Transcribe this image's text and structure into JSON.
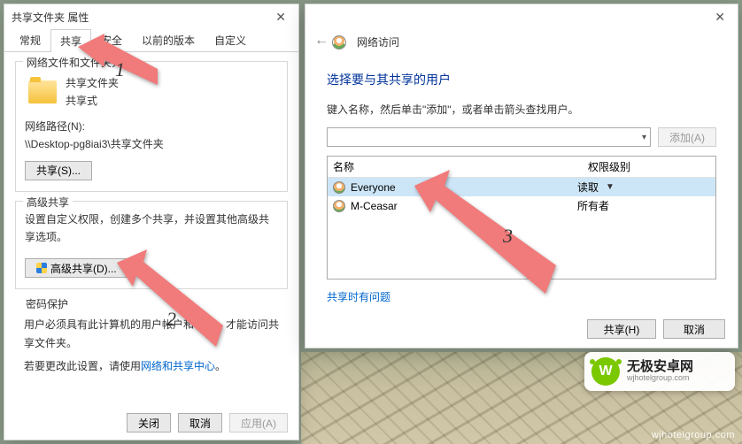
{
  "win1": {
    "title": "共享文件夹 属性",
    "tabs": [
      "常规",
      "共享",
      "安全",
      "以前的版本",
      "自定义"
    ],
    "active_tab": 1,
    "group1": {
      "title": "网络文件和文件夹共享",
      "folder_name": "共享文件夹",
      "status": "共享式",
      "path_label": "网络路径(N):",
      "path_value": "\\\\Desktop-pg8iai3\\共享文件夹",
      "share_btn": "共享(S)..."
    },
    "group2": {
      "title": "高级共享",
      "desc": "设置自定义权限，创建多个共享，并设置其他高级共享选项。",
      "adv_btn": "高级共享(D)..."
    },
    "group3": {
      "title": "密码保护",
      "line1_a": "用户必须具有此计算机的用户帐户和密码，才能访问共享文件夹。",
      "line2_a": "若要更改此设置，请使用",
      "link": "网络和共享中心",
      "line2_b": "。"
    },
    "footer": {
      "close": "关闭",
      "cancel": "取消",
      "apply": "应用(A)"
    }
  },
  "win2": {
    "header_icon": "people-icon",
    "header_text": "网络访问",
    "title": "选择要与其共享的用户",
    "hint": "键入名称，然后单击\"添加\"，或者单击箭头查找用户。",
    "add_btn": "添加(A)",
    "col_name": "名称",
    "col_perm": "权限级别",
    "rows": [
      {
        "name": "Everyone",
        "perm": "读取",
        "selected": true,
        "editable": true
      },
      {
        "name": "M-Ceasar",
        "perm": "所有者",
        "selected": false,
        "editable": false
      }
    ],
    "trouble_link": "共享时有问题",
    "footer": {
      "share": "共享(H)",
      "cancel": "取消"
    }
  },
  "arrows": {
    "a1": "1",
    "a2": "2",
    "a3": "3"
  },
  "brand": {
    "cn": "无极安卓网",
    "en": "wjhotelgroup.com"
  },
  "watermark": "wjhotelgroup.com"
}
